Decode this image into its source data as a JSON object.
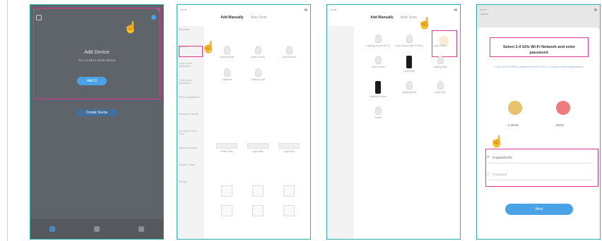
{
  "screens": {
    "add_device": {
      "title": "Add Device",
      "subtitle": "No 1 a add a smart device",
      "add_button": "Add D",
      "secondary_button": "Create Scene"
    },
    "add_manually": {
      "tab_manual": "Add Manually",
      "tab_auto": "Auto Scan",
      "categories": [
        "Electrician",
        "Lighting",
        "Large Home Appliances",
        "Small Home Appliances",
        "Kitchen Appliances",
        "Exercise & Health",
        "Security & Video Surv.",
        "Gateway Control",
        "Outdoor Travel",
        "Energy"
      ],
      "items": [
        "Lighting Bulb",
        "Light Source",
        "Light Source",
        "Smart Strip",
        "Lightbulb",
        "Light Strip",
        "Ceiling Light",
        "Light Strip",
        "Light Strip"
      ]
    },
    "device_grid": {
      "tab_manual": "Add Manually",
      "tab_auto": "Auto Scan",
      "items": [
        "Lighting Source (E27)",
        "Light Source (Wi-Fi+BLE)",
        "Light Source",
        "Light Source",
        "Lighting Bulb",
        "Light Strip",
        "Lighting Bulb",
        "Light Strip",
        "Outlet",
        "Lighting Source"
      ]
    },
    "wifi": {
      "back": "Cancel",
      "title": "Select 2.4 GHz Wi-Fi Network and enter password.",
      "desc": "If your Wi-Fi is 5GHz, please set it to be 2.4GHz. Common router setting method",
      "band_24": "2.4GHz",
      "band_5": "5GHz",
      "ssid": "Imagination01",
      "password_placeholder": "Password",
      "next_button": "Next"
    }
  },
  "colors": {
    "highlight": "#e0388f",
    "frame": "#2bb0a8",
    "accent": "#4aa3e6"
  }
}
